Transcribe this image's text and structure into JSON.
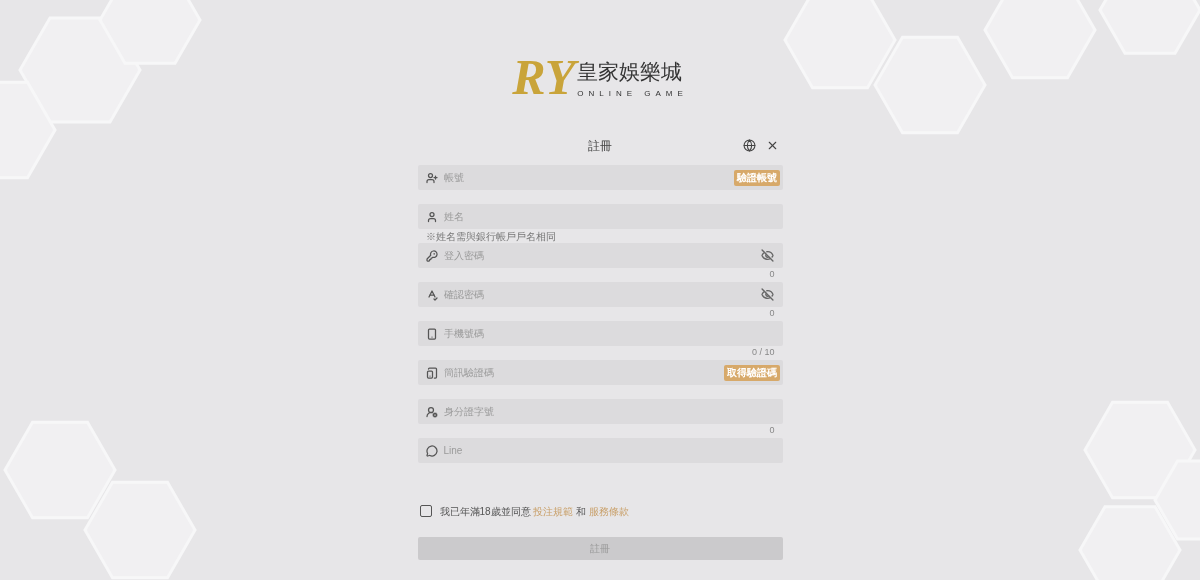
{
  "logo": {
    "monogram": "RY",
    "name": "皇家娛樂城",
    "tagline": "ONLINE GAME"
  },
  "dialog": {
    "title": "註冊"
  },
  "fields": [
    {
      "kind": "account",
      "placeholder": "帳號",
      "action": "驗證帳號"
    },
    {
      "kind": "name",
      "placeholder": "姓名",
      "note": "※姓名需與銀行帳戶戶名相同"
    },
    {
      "kind": "password",
      "placeholder": "登入密碼",
      "masked": true,
      "counter": "0"
    },
    {
      "kind": "confirm",
      "placeholder": "確認密碼",
      "masked": true,
      "counter": "0"
    },
    {
      "kind": "phone",
      "placeholder": "手機號碼",
      "counter": "0 / 10"
    },
    {
      "kind": "sms",
      "placeholder": "簡訊驗證碼",
      "action": "取得驗證碼"
    },
    {
      "kind": "id",
      "placeholder": "身分證字號",
      "counter": "0"
    },
    {
      "kind": "line",
      "placeholder": "Line"
    }
  ],
  "agreement": {
    "checked": false,
    "text": "我已年滿18歲並同意",
    "link1": "投注規範",
    "joiner": "和",
    "link2": "服務條款"
  },
  "submit": {
    "label": "註冊",
    "disabled": true
  }
}
